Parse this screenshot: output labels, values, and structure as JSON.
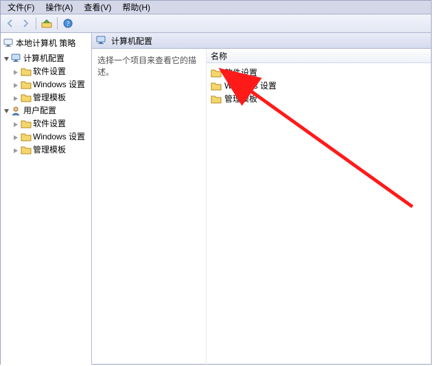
{
  "menus": {
    "file": "文件(F)",
    "action": "操作(A)",
    "view": "查看(V)",
    "help": "帮助(H)"
  },
  "tree": {
    "root_label": "本地计算机 策略",
    "computer_config": "计算机配置",
    "user_config": "用户配置",
    "software_settings": "软件设置",
    "windows_settings": "Windows 设置",
    "admin_templates": "管理模板"
  },
  "main": {
    "header_title": "计算机配置",
    "desc_prompt": "选择一个项目来查看它的描述。",
    "column_name": "名称",
    "items": [
      {
        "label": "软件设置"
      },
      {
        "label": "Windows 设置"
      },
      {
        "label": "管理模板"
      }
    ]
  }
}
